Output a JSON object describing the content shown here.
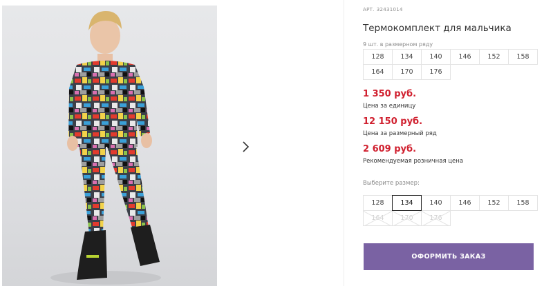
{
  "product": {
    "article_label": "АРТ.",
    "article_number": "32431014",
    "title": "Термокомплект для мальчика"
  },
  "size_row": {
    "note": "9 шт. в размерном ряду",
    "sizes": [
      "128",
      "134",
      "140",
      "146",
      "152",
      "158",
      "164",
      "170",
      "176"
    ]
  },
  "prices": {
    "unit_price": "1 350 руб.",
    "unit_price_note": "Цена за единицу",
    "row_price": "12 150 руб.",
    "row_price_note": "Цена за размерный ряд",
    "retail_price": "2 609 руб.",
    "retail_price_note": "Рекомендуемая розничная цена"
  },
  "size_select": {
    "label": "Выберите размер:",
    "selected": "134",
    "options": [
      {
        "label": "128",
        "available": true
      },
      {
        "label": "134",
        "available": true
      },
      {
        "label": "140",
        "available": true
      },
      {
        "label": "146",
        "available": true
      },
      {
        "label": "152",
        "available": true
      },
      {
        "label": "158",
        "available": true
      },
      {
        "label": "164",
        "available": false
      },
      {
        "label": "170",
        "available": false
      },
      {
        "label": "176",
        "available": false
      }
    ]
  },
  "order_button": {
    "label": "ОФОРМИТЬ ЗАКАЗ"
  },
  "colors": {
    "price_red": "#d0202f",
    "button_purple": "#7a62a3"
  },
  "icons": {
    "next": "chevron-right-icon"
  }
}
